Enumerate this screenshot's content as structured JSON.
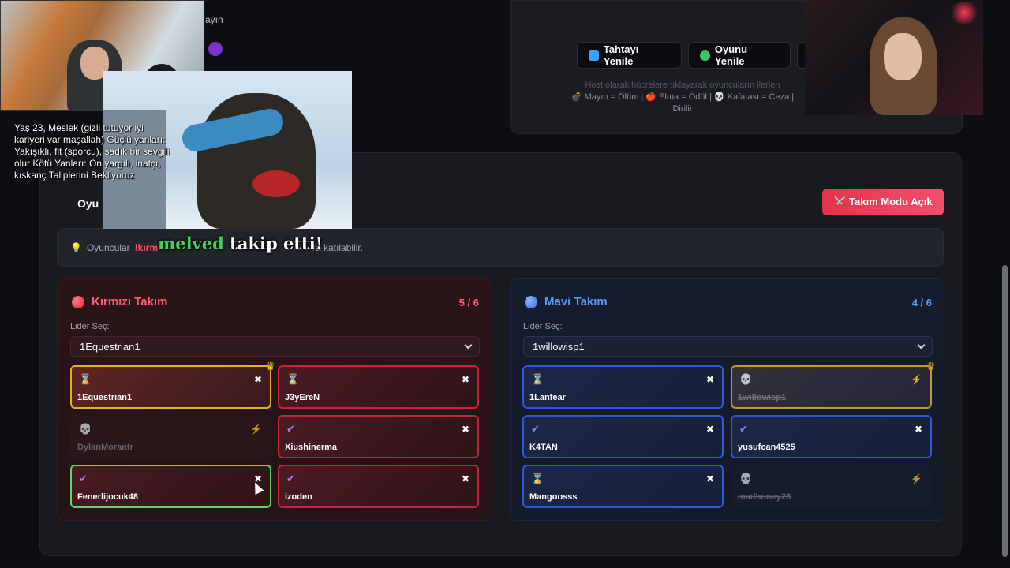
{
  "header": {
    "refresh_board_label": "Tahtayı Yenile",
    "refresh_game_label": "Oyunu Yenile",
    "host_hint_line1": "Host olarak hücrelere tıklayarak oyuncuların ilerlen",
    "host_hint_line2": "💣 Mayın = Ölüm | 🍎 Elma = Ödül | 💀 Kafatası = Ceza |",
    "host_hint_line3": "Dirilir",
    "partial_text": "ayın"
  },
  "team_mode_button": "⚔️ Takım Modu Açık",
  "info_bar": {
    "prefix": "Oyuncular",
    "red_cmd": "!kırm",
    "suffix": "ra katılabilir."
  },
  "overlay": {
    "bio": "Yaş 23, Meslek (gizli tutuyor iyi kariyeri var maşallah) Güçlü yanları: Yakışıklı, fit (sporcu), sadık bir sevgili olur Kötü Yanları: Ön yargılı, inatçı, kıskanç Taliplerini Bekliyoruz",
    "oyun_label": "Oyu",
    "follow_user": "melved",
    "follow_msg": " takip etti!"
  },
  "teams": {
    "red": {
      "name": "Kırmızı Takım",
      "count": "5 / 6",
      "leader_label": "Lider Seç:",
      "leader_value": "1Equestrian1",
      "players": [
        {
          "name": "1Equestrian1",
          "status": "⌛",
          "action": "✖",
          "leader": true,
          "dead": false,
          "selected": false
        },
        {
          "name": "J3yEreN",
          "status": "⌛",
          "action": "✖",
          "leader": false,
          "dead": false,
          "selected": false
        },
        {
          "name": "DylanMorantr",
          "status": "💀",
          "action": "⚡",
          "leader": false,
          "dead": true,
          "selected": false
        },
        {
          "name": "Xiushinerma",
          "status": "✔",
          "action": "✖",
          "leader": false,
          "dead": false,
          "selected": false
        },
        {
          "name": "Fenerlijocuk48",
          "status": "✔",
          "action": "✖",
          "leader": false,
          "dead": false,
          "selected": true
        },
        {
          "name": "izoden",
          "status": "✔",
          "action": "✖",
          "leader": false,
          "dead": false,
          "selected": false
        }
      ]
    },
    "blue": {
      "name": "Mavi Takım",
      "count": "4 / 6",
      "leader_label": "Lider Seç:",
      "leader_value": "1willowisp1",
      "players": [
        {
          "name": "1Lanfear",
          "status": "⌛",
          "action": "✖",
          "leader": false,
          "dead": false
        },
        {
          "name": "1willowisp1",
          "status": "💀",
          "action": "⚡",
          "leader": true,
          "dead": true
        },
        {
          "name": "K4TAN",
          "status": "✔",
          "action": "✖",
          "leader": false,
          "dead": false
        },
        {
          "name": "yusufcan4525",
          "status": "✔",
          "action": "✖",
          "leader": false,
          "dead": false
        },
        {
          "name": "Mangoosss",
          "status": "⌛",
          "action": "✖",
          "leader": false,
          "dead": false
        },
        {
          "name": "madhoney28",
          "status": "💀",
          "action": "⚡",
          "leader": false,
          "dead": true
        }
      ]
    }
  },
  "icons": {
    "crown": "crown-icon",
    "hourglass": "hourglass-icon",
    "check": "check-icon",
    "skull": "skull-icon",
    "close": "close-icon",
    "bolt": "bolt-icon"
  },
  "colors": {
    "red_accent": "#ff5b70",
    "blue_accent": "#5b9bff",
    "leader_border": "#e0b02a",
    "selected_border": "#5fd46a",
    "team_mode_button": "#e5334b"
  }
}
